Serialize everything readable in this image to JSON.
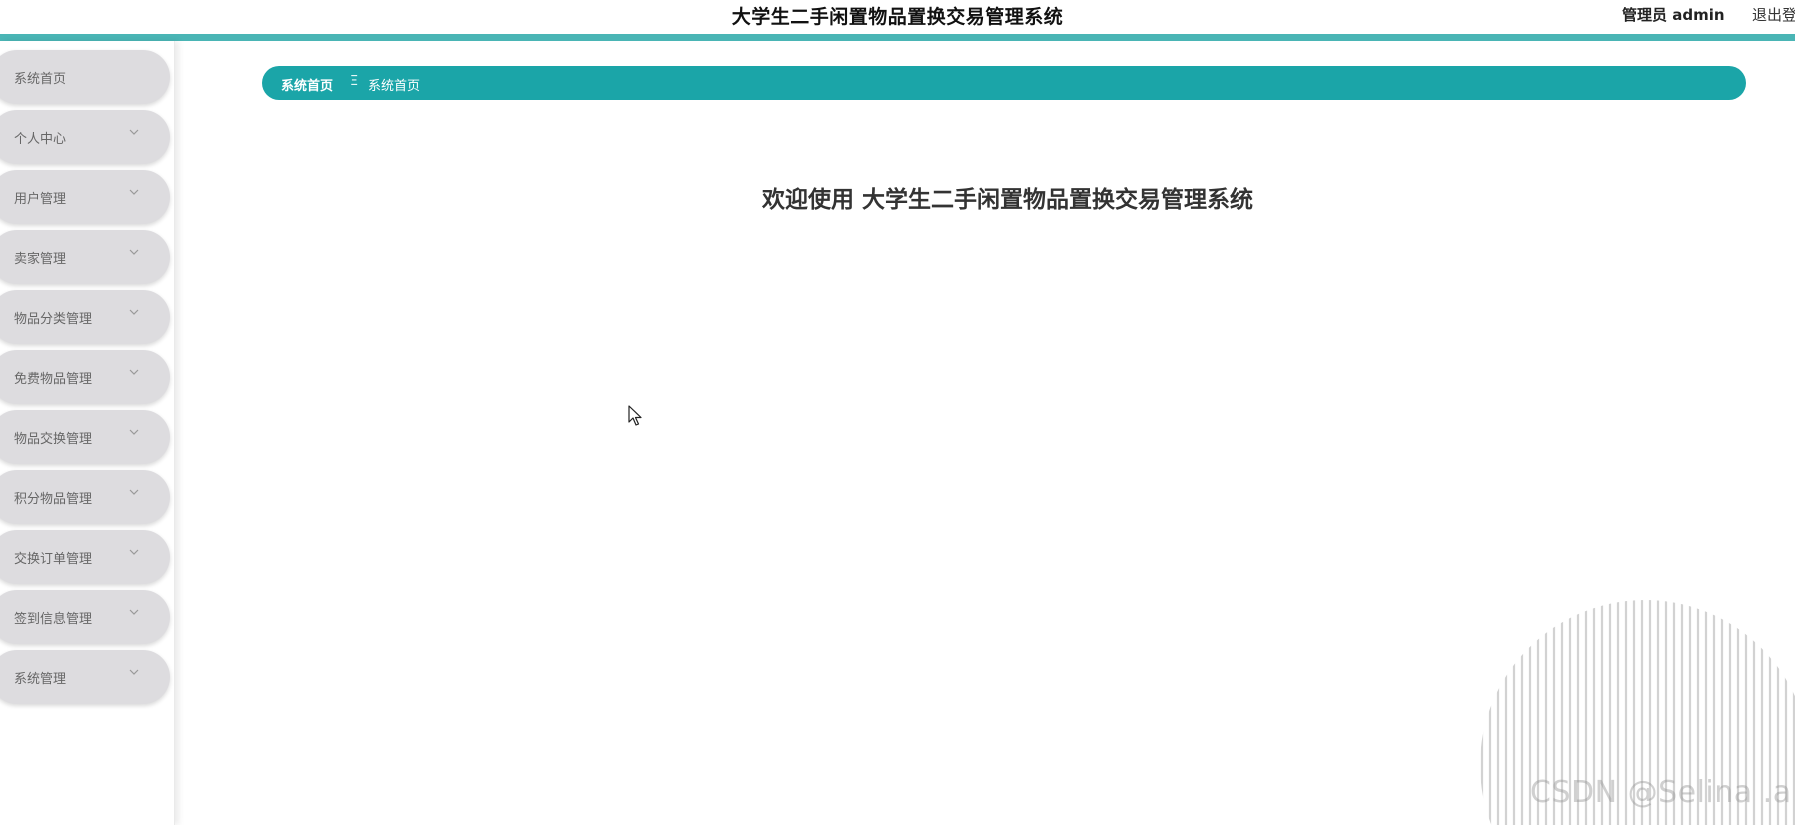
{
  "header": {
    "title": "大学生二手闲置物品置换交易管理系统",
    "admin_label": "管理员 admin",
    "logout_label": "退出登录"
  },
  "sidebar": {
    "items": [
      {
        "label": "系统首页",
        "has_submenu": false
      },
      {
        "label": "个人中心",
        "has_submenu": true
      },
      {
        "label": "用户管理",
        "has_submenu": true
      },
      {
        "label": "卖家管理",
        "has_submenu": true
      },
      {
        "label": "物品分类管理",
        "has_submenu": true
      },
      {
        "label": "免费物品管理",
        "has_submenu": true
      },
      {
        "label": "物品交换管理",
        "has_submenu": true
      },
      {
        "label": "积分物品管理",
        "has_submenu": true
      },
      {
        "label": "交换订单管理",
        "has_submenu": true
      },
      {
        "label": "签到信息管理",
        "has_submenu": true
      },
      {
        "label": "系统管理",
        "has_submenu": true
      }
    ]
  },
  "breadcrumb": {
    "home": "系统首页",
    "separator": "Ξ",
    "current": "系统首页"
  },
  "main": {
    "welcome": "欢迎使用 大学生二手闲置物品置换交易管理系统"
  },
  "watermark": "CSDN @Selina .a",
  "colors": {
    "accent": "#1ba5a8",
    "topline": "#4ab5b5",
    "menu_bg": "#dddcdf"
  },
  "icons": {
    "chevron": "chevron-down-icon",
    "cursor": "mouse-pointer-icon"
  }
}
